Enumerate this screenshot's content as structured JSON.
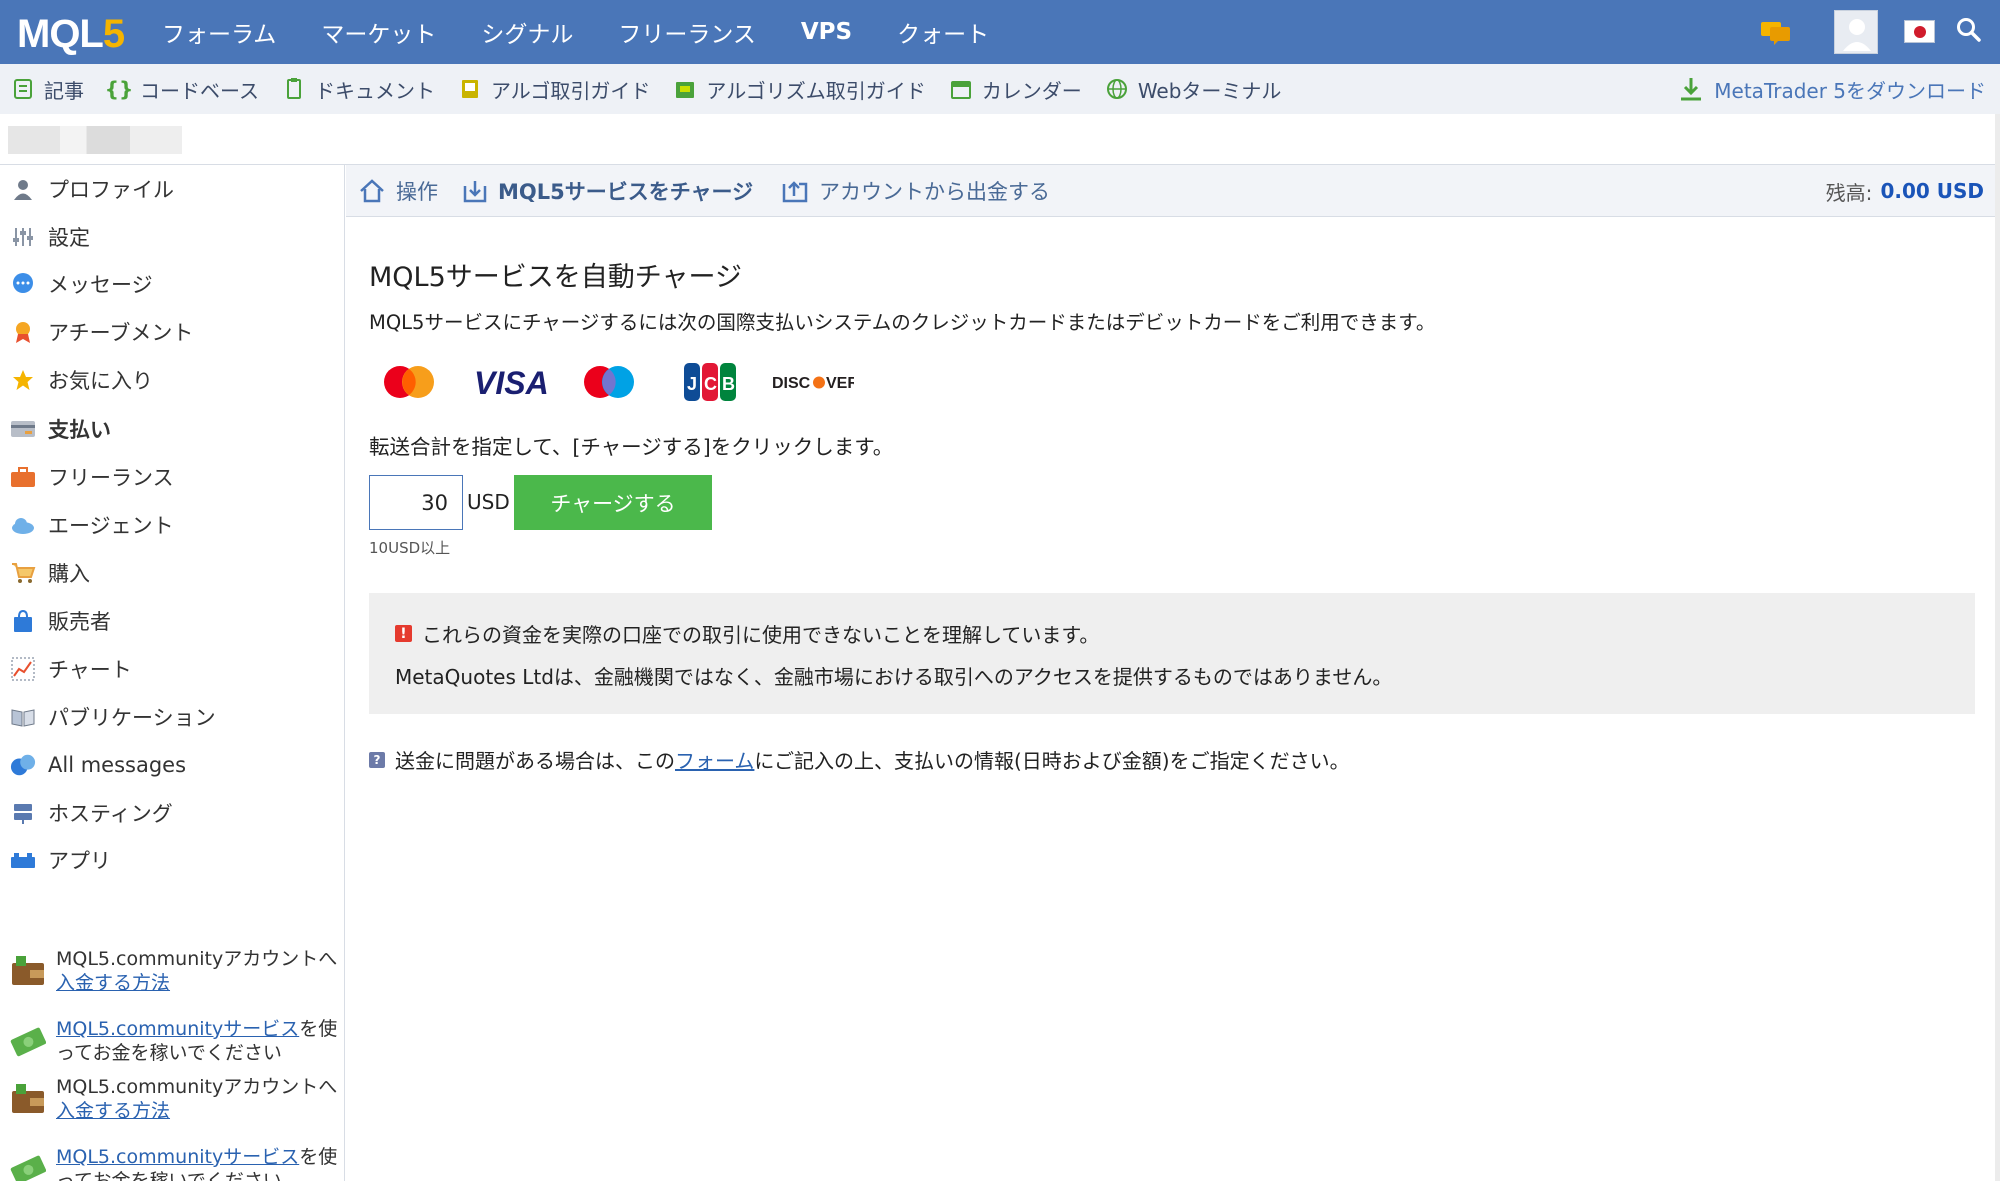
{
  "topnav": {
    "logo_main": "MQL",
    "logo_accent": "5",
    "items": [
      "フォーラム",
      "マーケット",
      "シグナル",
      "フリーランス",
      "VPS",
      "クォート"
    ]
  },
  "subnav": {
    "items": [
      "記事",
      "コードベース",
      "ドキュメント",
      "アルゴ取引ガイド",
      "アルゴリズム取引ガイド",
      "カレンダー",
      "Webターミナル"
    ],
    "download_label": "MetaTrader 5をダウンロード"
  },
  "sidebar": {
    "items": [
      "プロファイル",
      "設定",
      "メッセージ",
      "アチーブメント",
      "お気に入り",
      "支払い",
      "フリーランス",
      "エージェント",
      "購入",
      "販売者",
      "チャート",
      "パブリケーション",
      "All messages",
      "ホスティング",
      "アプリ"
    ],
    "active_item": "支払い",
    "promos": [
      {
        "text_pre": "MQL5.communityアカウントへ",
        "link": "入金する方法",
        "text_post": ""
      },
      {
        "text_pre": "",
        "link": "MQL5.communityサービス",
        "text_post": "を使ってお金を稼いでください"
      },
      {
        "text_pre": "MQL5.communityアカウントへ",
        "link": "入金する方法",
        "text_post": ""
      },
      {
        "text_pre": "",
        "link": "MQL5.communityサービス",
        "text_post": "を使ってお金を稼いでください"
      }
    ]
  },
  "tabs": {
    "items": [
      "操作",
      "MQL5サービスをチャージ",
      "アカウントから出金する"
    ],
    "active": "MQL5サービスをチャージ",
    "balance_label": "残高:",
    "balance_value": "0.00 USD"
  },
  "main": {
    "title": "MQL5サービスを自動チャージ",
    "description": "MQL5サービスにチャージするには次の国際支払いシステムのクレジットカードまたはデビットカードをご利用できます。",
    "cards": [
      "mastercard",
      "visa",
      "maestro",
      "jcb",
      "discover"
    ],
    "instruction": "転送合計を指定して、[チャージする]をクリックします。",
    "amount_value": "30",
    "currency": "USD",
    "charge_button": "チャージする",
    "min_note": "10USD以上",
    "warning_line1": "これらの資金を実際の口座での取引に使用できないことを理解しています。",
    "warning_line2": "MetaQuotes Ltdは、金融機関ではなく、金融市場における取引へのアクセスを提供するものではありません。",
    "help_pre": "送金に問題がある場合は、この",
    "help_link": "フォーム",
    "help_post": "にご記入の上、支払いの情報(日時および金額)をご指定ください。"
  },
  "colors": {
    "header_blue": "#4a76b8",
    "charge_green": "#4bb84b",
    "link_blue": "#2a62b0",
    "balance_blue": "#1a54b8"
  }
}
